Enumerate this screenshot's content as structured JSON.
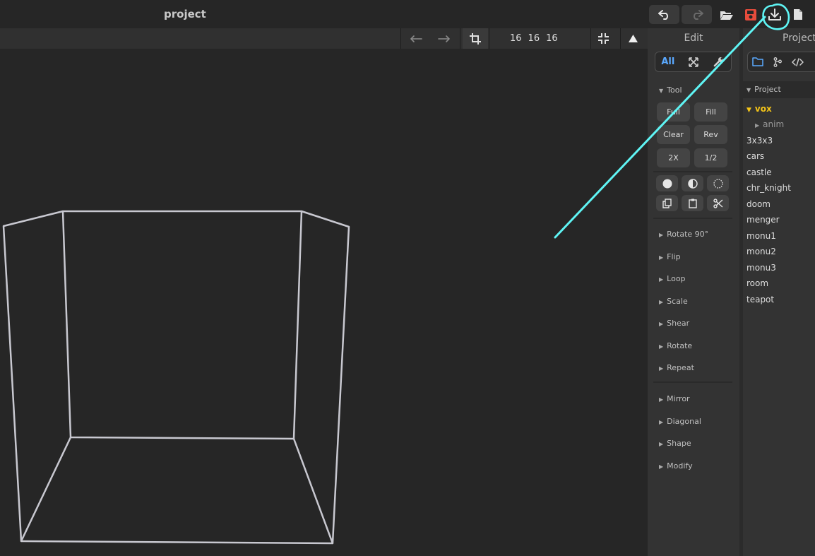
{
  "app": {
    "title": "project"
  },
  "toolbar": {
    "dims": [
      "16",
      "16",
      "16"
    ]
  },
  "edit": {
    "header": "Edit",
    "tabs": {
      "all": "All"
    },
    "tool_section": "Tool",
    "buttons": [
      "Full",
      "Fill",
      "Clear",
      "Rev",
      "2X",
      "1/2"
    ],
    "sections_a": [
      "Rotate 90°",
      "Flip",
      "Loop",
      "Scale",
      "Shear",
      "Rotate",
      "Repeat"
    ],
    "sections_b": [
      "Mirror",
      "Diagonal",
      "Shape",
      "Modify"
    ]
  },
  "project": {
    "header": "Project",
    "tree_title": "Project",
    "folder": "vox",
    "subfolder": "anim",
    "items": [
      "3x3x3",
      "cars",
      "castle",
      "chr_knight",
      "doom",
      "menger",
      "monu1",
      "monu2",
      "monu3",
      "room",
      "teapot"
    ]
  },
  "colors": {
    "accent": "#5aa9ff",
    "save_red": "#e74c3c",
    "folder_yellow": "#f5c518",
    "annotation": "#5ff5f5"
  },
  "icons": {
    "top": [
      "undo-icon",
      "redo-icon",
      "open-folder-icon",
      "save-icon",
      "download-icon",
      "new-file-icon"
    ],
    "toolbar": [
      "arrow-left-icon",
      "arrow-right-icon",
      "crop-icon",
      "compress-icon",
      "triangle-up-icon"
    ],
    "edit_tabs": [
      "expand-icon",
      "wrench-icon"
    ],
    "edit_tools": [
      "circle-filled-icon",
      "circle-half-icon",
      "circle-dashed-icon",
      "copy-icon",
      "paste-icon",
      "scissors-icon"
    ],
    "project_tabs": [
      "folder-icon",
      "branch-icon",
      "code-icon"
    ]
  }
}
